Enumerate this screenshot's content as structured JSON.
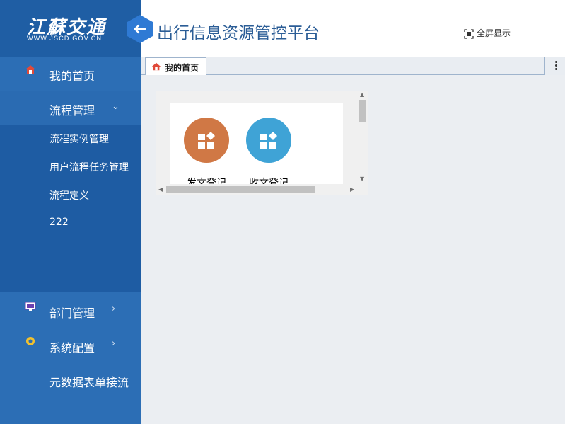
{
  "brand": {
    "logo_cn": "江蘇交通",
    "logo_en": "WWW.JSCD.GOV.CN"
  },
  "header": {
    "title": "出行信息资源管控平台",
    "fullscreen_label": "全屏显示"
  },
  "sidebar": {
    "items": [
      {
        "label": "我的首页",
        "icon": "home-icon"
      },
      {
        "label": "流程管理",
        "expanded": true
      },
      {
        "label": "部门管理",
        "icon": "monitor-icon"
      },
      {
        "label": "系统配置",
        "icon": "gear-icon"
      },
      {
        "label": "元数据表单接流"
      }
    ],
    "submenu": [
      {
        "label": "流程实例管理"
      },
      {
        "label": "用户流程任务管理"
      },
      {
        "label": "流程定义"
      },
      {
        "label": "222"
      }
    ]
  },
  "tabs": [
    {
      "label": "我的首页",
      "icon": "home-icon",
      "active": true
    }
  ],
  "apps": [
    {
      "label": "发文登记",
      "color": "#d07845"
    },
    {
      "label": "收文登记",
      "color": "#3fa3d6"
    }
  ],
  "colors": {
    "sidebar_bg": "#2c6eb5",
    "submenu_bg": "#1e5ca3",
    "accent": "#2f7ad4",
    "title_color": "#2b5d96"
  }
}
